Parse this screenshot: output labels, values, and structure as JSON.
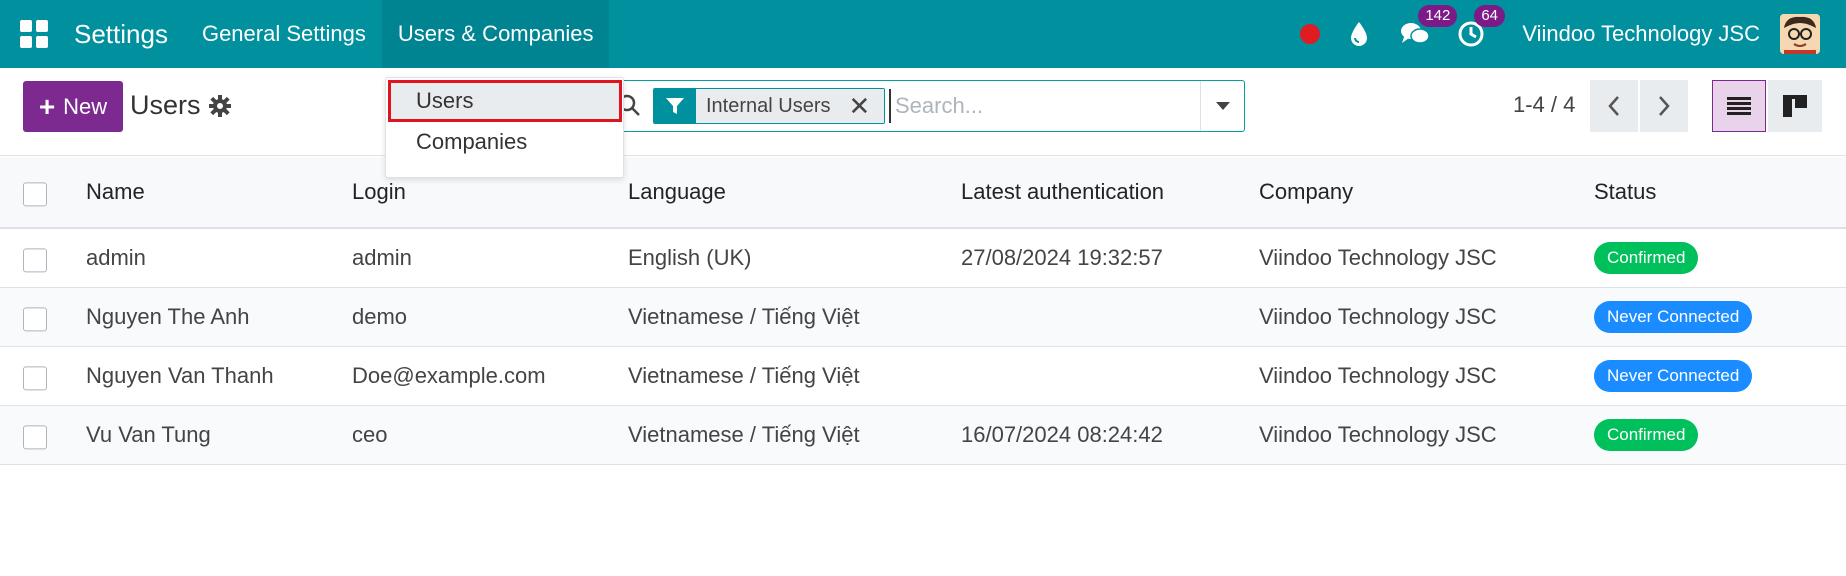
{
  "navbar": {
    "app_title": "Settings",
    "menu": [
      "General Settings",
      "Users & Companies"
    ],
    "company_name": "Viindoo Technology JSC",
    "messages_count": "142",
    "activities_count": "64",
    "accent_color": "#00909e"
  },
  "dropdown": {
    "items": [
      "Users",
      "Companies"
    ]
  },
  "control": {
    "new_label": "New",
    "title": "Users",
    "facet_label": "Internal Users",
    "facet_close": "✕",
    "search_placeholder": "Search...",
    "pager": "1-4 / 4"
  },
  "table": {
    "columns": [
      "Name",
      "Login",
      "Language",
      "Latest authentication",
      "Company",
      "Status"
    ],
    "rows": [
      {
        "name": "admin",
        "login": "admin",
        "language": "English (UK)",
        "auth": "27/08/2024 19:32:57",
        "company": "Viindoo Technology JSC",
        "status": "Confirmed",
        "status_color": "#00c05b"
      },
      {
        "name": "Nguyen The Anh",
        "login": "demo",
        "language": "Vietnamese / Tiếng Việt",
        "auth": "",
        "company": "Viindoo Technology JSC",
        "status": "Never Connected",
        "status_color": "#1a8cff"
      },
      {
        "name": "Nguyen Van Thanh",
        "login": "Doe@example.com",
        "language": "Vietnamese / Tiếng Việt",
        "auth": "",
        "company": "Viindoo Technology JSC",
        "status": "Never Connected",
        "status_color": "#1a8cff"
      },
      {
        "name": "Vu Van Tung",
        "login": "ceo",
        "language": "Vietnamese / Tiếng Việt",
        "auth": "16/07/2024 08:24:42",
        "company": "Viindoo Technology JSC",
        "status": "Confirmed",
        "status_color": "#00c05b"
      }
    ]
  }
}
